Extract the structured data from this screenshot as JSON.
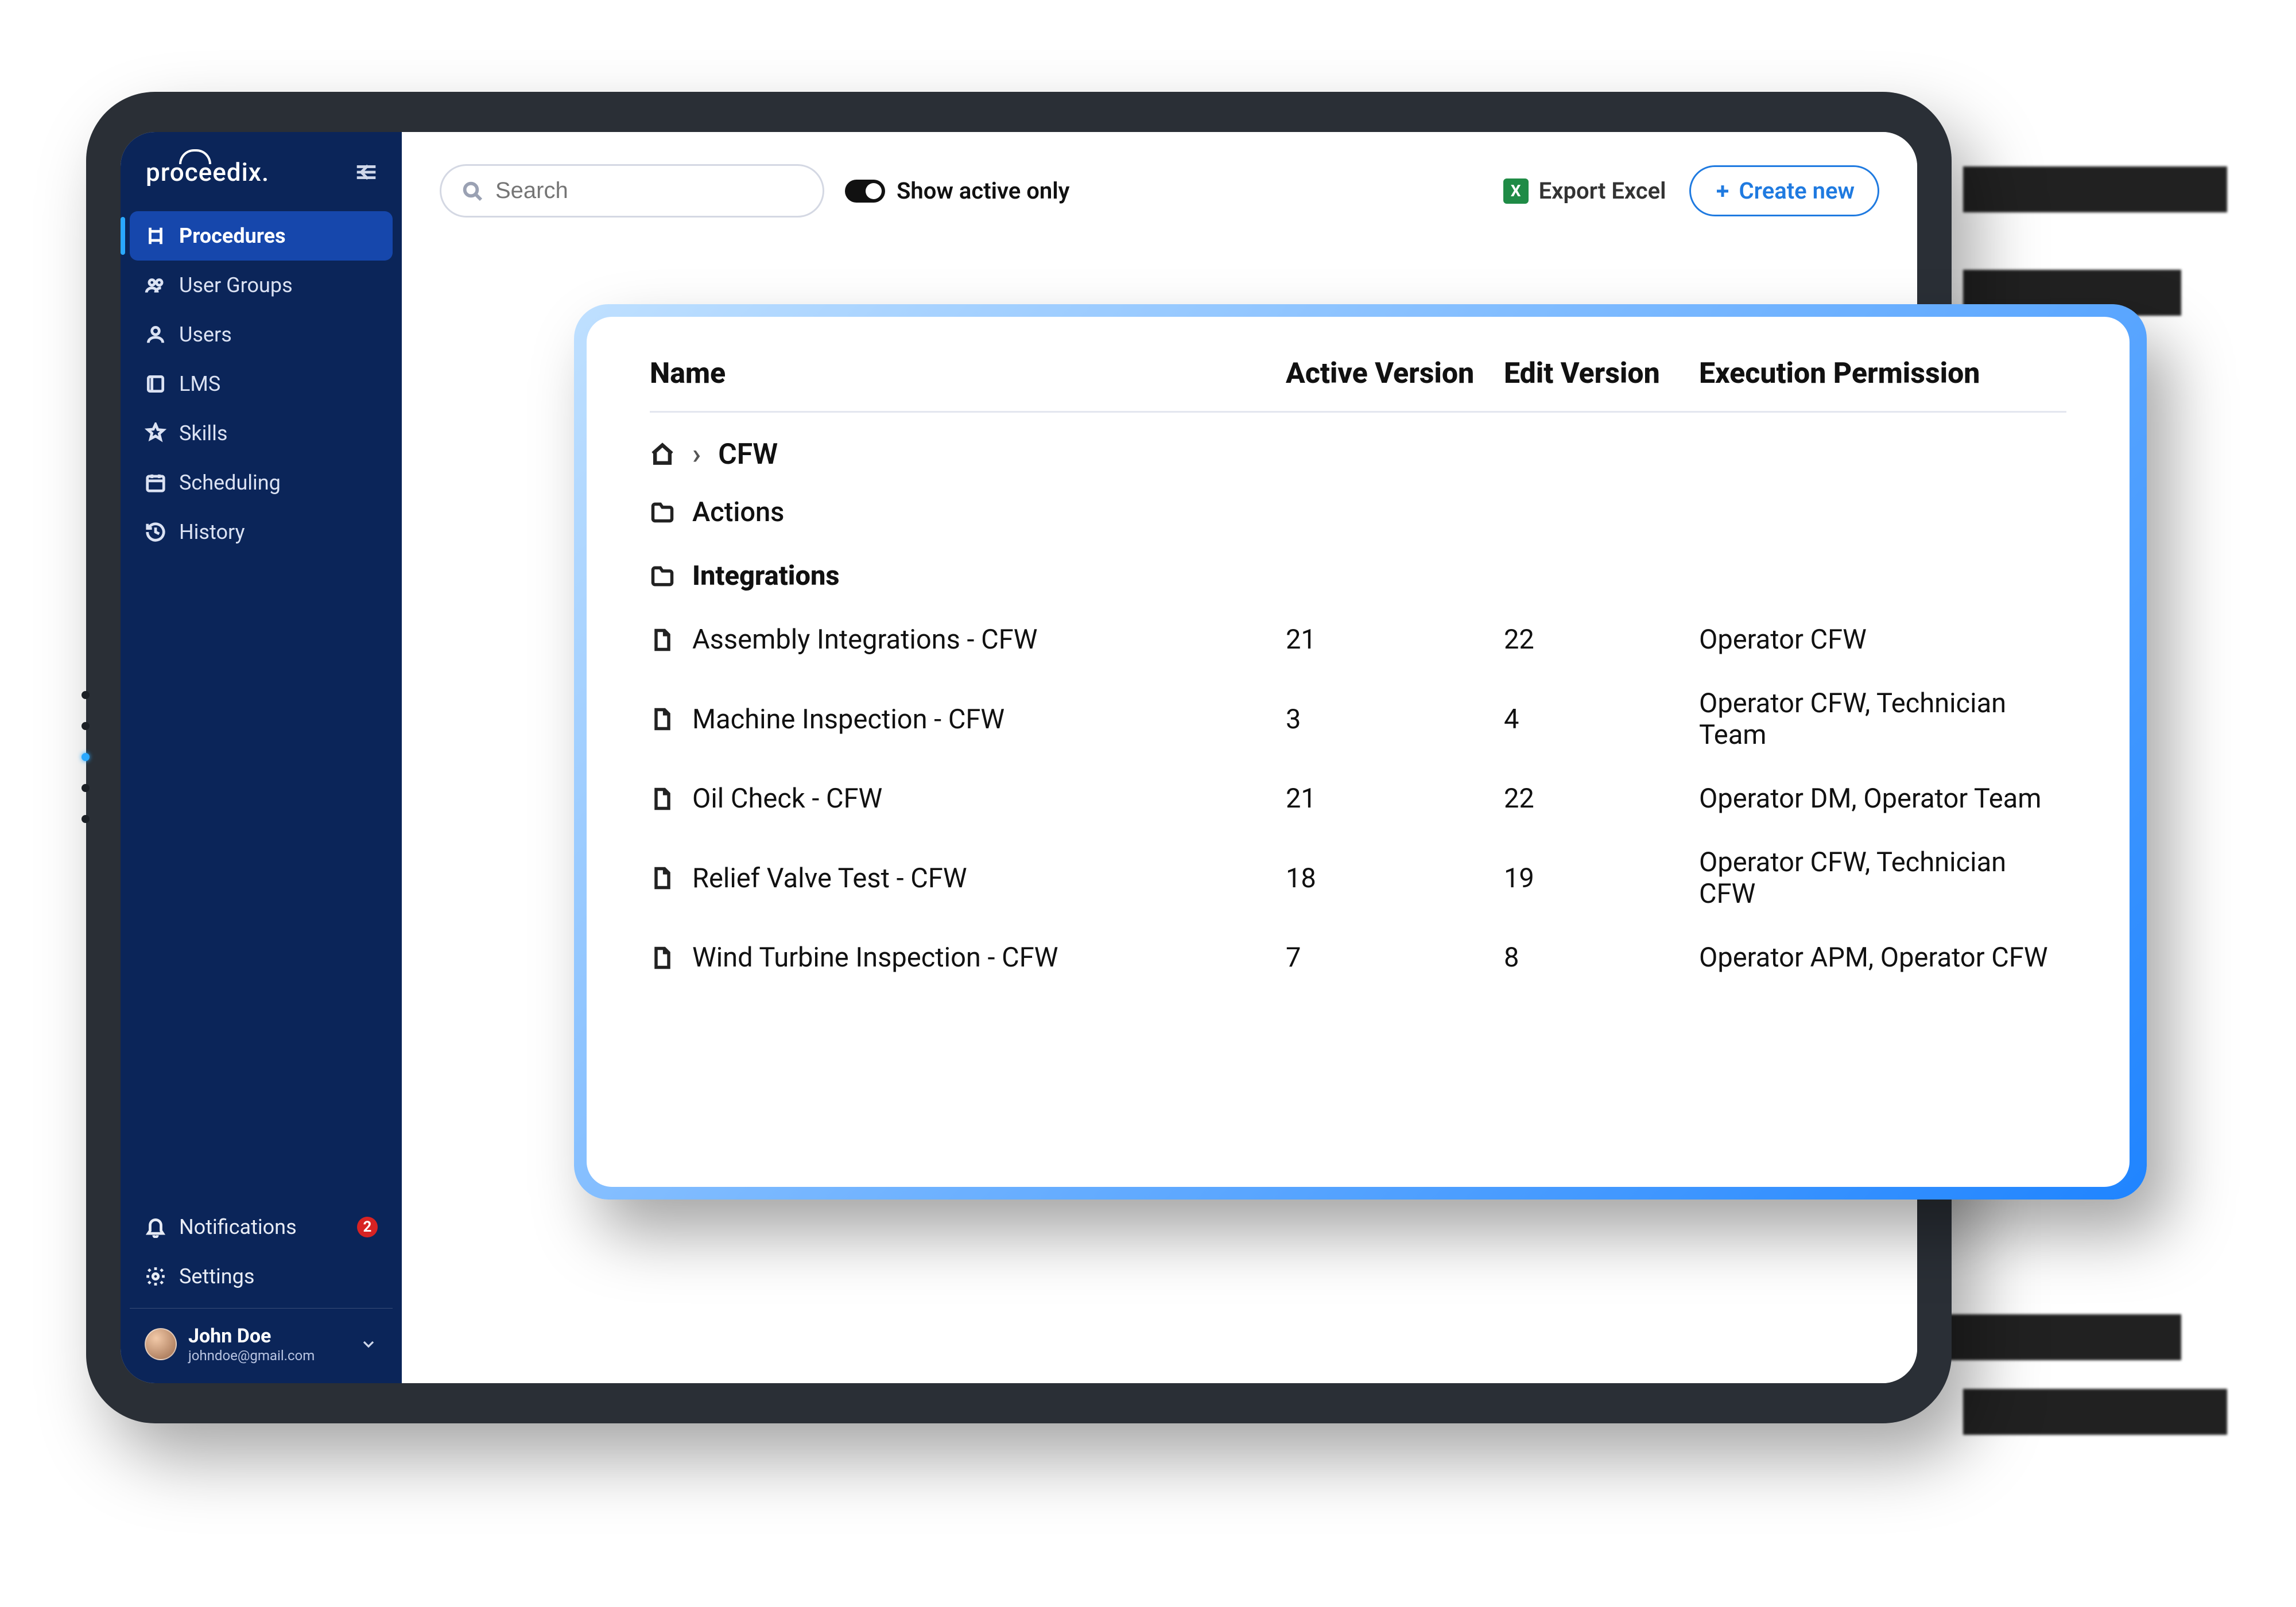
{
  "brand": "proceedix.",
  "sidebar": {
    "items": [
      {
        "label": "Procedures"
      },
      {
        "label": "User Groups"
      },
      {
        "label": "Users"
      },
      {
        "label": "LMS"
      },
      {
        "label": "Skills"
      },
      {
        "label": "Scheduling"
      },
      {
        "label": "History"
      }
    ],
    "notifications": {
      "label": "Notifications",
      "count": "2"
    },
    "settings": {
      "label": "Settings"
    },
    "user": {
      "name": "John Doe",
      "email": "johndoe@gmail.com"
    }
  },
  "toolbar": {
    "search_placeholder": "Search",
    "toggle_label": "Show active only",
    "export_label": "Export Excel",
    "create_label": "Create new"
  },
  "table": {
    "columns": {
      "name": "Name",
      "active": "Active Version",
      "edit": "Edit Version",
      "perm": "Execution Permission"
    },
    "breadcrumb": "CFW",
    "folders": [
      {
        "label": "Actions"
      },
      {
        "label": "Integrations"
      }
    ],
    "rows": [
      {
        "name": "Assembly Integrations - CFW",
        "active": "21",
        "edit": "22",
        "perm": "Operator CFW"
      },
      {
        "name": "Machine Inspection - CFW",
        "active": "3",
        "edit": "4",
        "perm": "Operator CFW, Technician Team"
      },
      {
        "name": "Oil Check - CFW",
        "active": "21",
        "edit": "22",
        "perm": "Operator DM, Operator Team"
      },
      {
        "name": "Relief Valve Test - CFW",
        "active": "18",
        "edit": "19",
        "perm": "Operator CFW, Technician CFW"
      },
      {
        "name": "Wind Turbine Inspection - CFW",
        "active": "7",
        "edit": "8",
        "perm": "Operator APM, Operator CFW"
      }
    ]
  }
}
